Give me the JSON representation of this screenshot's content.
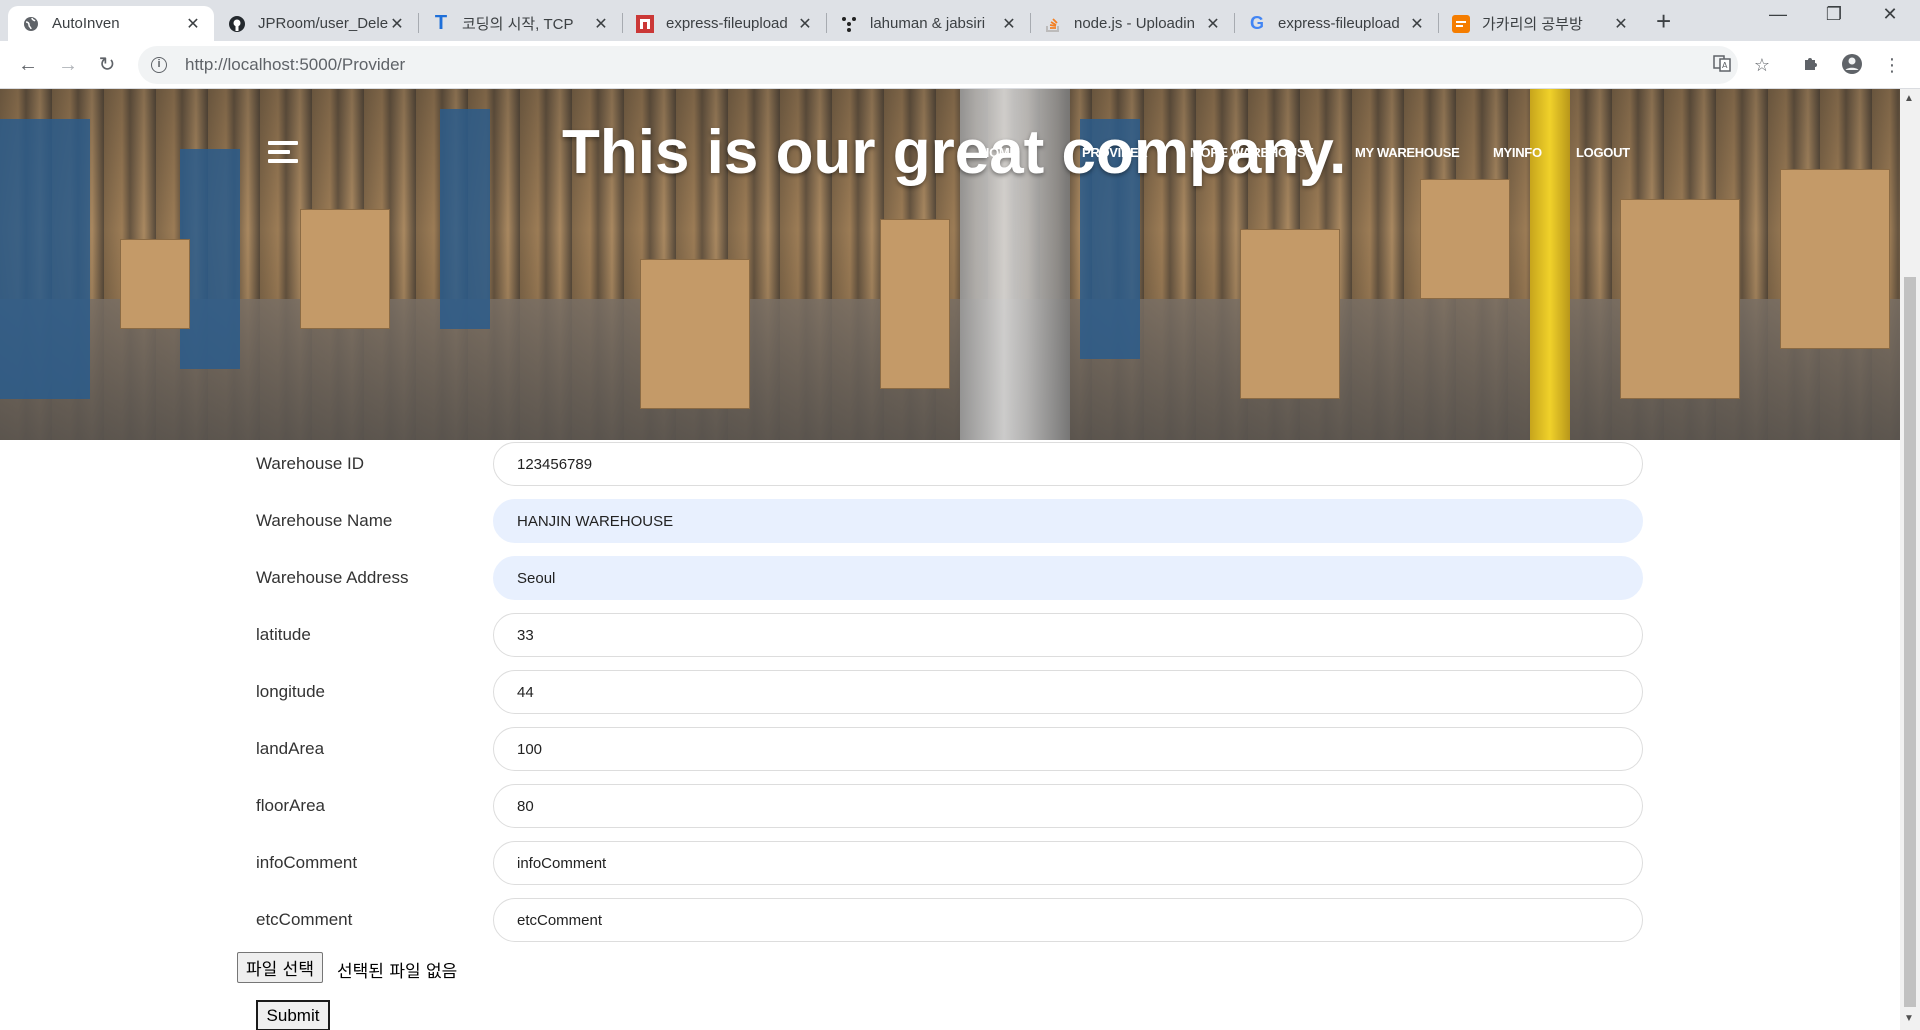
{
  "browser": {
    "tabs": [
      {
        "title": "AutoInven",
        "favicon": "globe-icon",
        "active": true
      },
      {
        "title": "JPRoom/user_Dele",
        "favicon": "github-icon"
      },
      {
        "title": "코딩의 시작, TCP",
        "favicon": "tcp-school-icon"
      },
      {
        "title": "express-fileupload",
        "favicon": "npm-icon"
      },
      {
        "title": "lahuman & jabsiri",
        "favicon": "dots-icon"
      },
      {
        "title": "node.js - Uploadin",
        "favicon": "stackoverflow-icon"
      },
      {
        "title": "express-fileupload",
        "favicon": "google-icon"
      },
      {
        "title": "가카리의 공부방",
        "favicon": "blogger-icon"
      }
    ],
    "url": "http://localhost:5000/Provider"
  },
  "hero": {
    "headline": "This is our great company.",
    "nav": [
      "HOME",
      "PROVIDER",
      "MORE WAREHOUSE",
      "MY WAREHOUSE",
      "MYINFO",
      "LOGOUT"
    ]
  },
  "form": {
    "fields": [
      {
        "label": "Warehouse ID",
        "value": "123456789",
        "autofilled": false
      },
      {
        "label": "Warehouse Name",
        "value": "HANJIN WAREHOUSE",
        "autofilled": true
      },
      {
        "label": "Warehouse Address",
        "value": "Seoul",
        "autofilled": true
      },
      {
        "label": "latitude",
        "value": "33",
        "autofilled": false
      },
      {
        "label": "longitude",
        "value": "44",
        "autofilled": false
      },
      {
        "label": "landArea",
        "value": "100",
        "autofilled": false
      },
      {
        "label": "floorArea",
        "value": "80",
        "autofilled": false
      },
      {
        "label": "infoComment",
        "value": "infoComment",
        "autofilled": false
      },
      {
        "label": "etcComment",
        "value": "etcComment",
        "autofilled": false
      }
    ],
    "file_button": "파일 선택",
    "file_status": "선택된 파일 없음",
    "submit": "Submit"
  }
}
